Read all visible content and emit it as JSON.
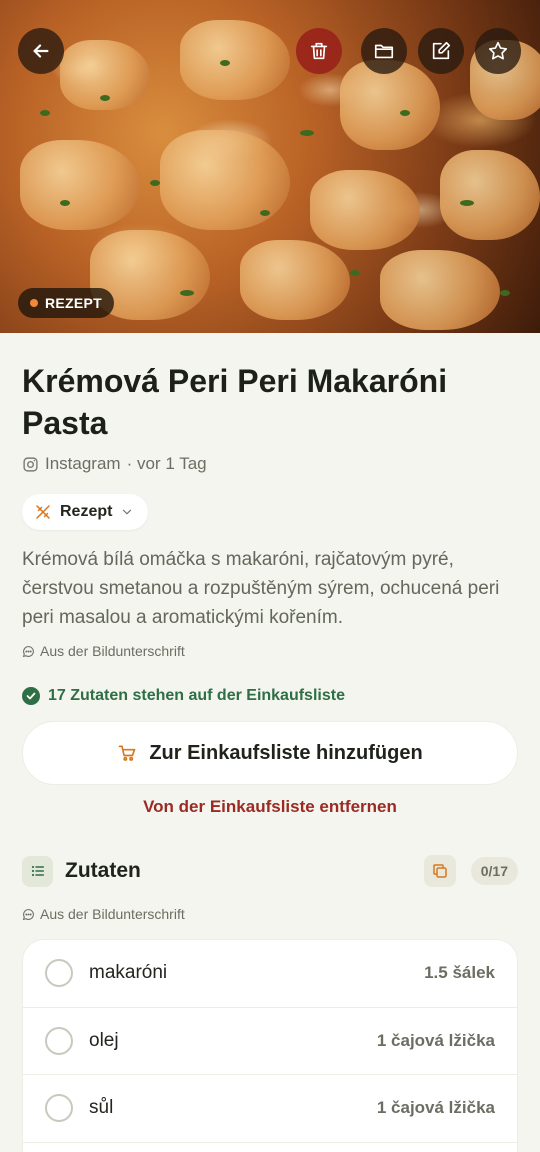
{
  "hero": {
    "badge_label": "REZEPT",
    "icons": [
      "back-arrow-icon",
      "trash-icon",
      "folder-icon",
      "edit-icon",
      "star-icon"
    ]
  },
  "recipe": {
    "title": "Krémová Peri Peri Makaróni Pasta",
    "source": "Instagram",
    "time": "· vor 1 Tag",
    "type_label": "Rezept",
    "description": "Krémová bílá omáčka s makaróni, rajčatovým pyré, čerstvou smetanou a rozpuštěným sýrem, ochucená peri peri masalou a aromatickými kořením.",
    "caption_source": "Aus der Bildunterschrift"
  },
  "shopping": {
    "status": "17 Zutaten stehen auf der Einkaufsliste",
    "add_label": "Zur Einkaufsliste hinzufügen",
    "remove_label": "Von der Einkaufsliste entfernen"
  },
  "ingredients": {
    "title": "Zutaten",
    "count": "0/17",
    "caption_source": "Aus der Bildunterschrift",
    "items": [
      {
        "name": "makaróni",
        "qty": "1.5 šálek"
      },
      {
        "name": "olej",
        "qty": "1 čajová lžička"
      },
      {
        "name": "sůl",
        "qty": "1 čajová lžička"
      }
    ]
  },
  "colors": {
    "accent_green": "#2e6f45",
    "danger_red": "#9b2a24",
    "badge_dot": "#f08a3a",
    "background": "#f3f5ee"
  }
}
